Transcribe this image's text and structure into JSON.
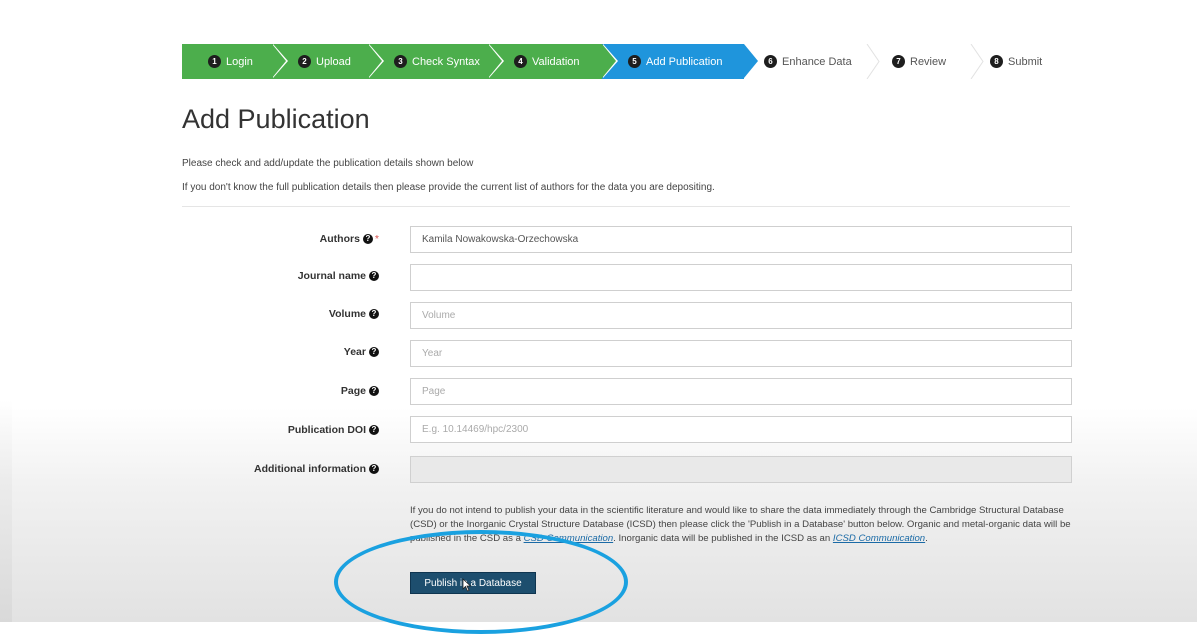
{
  "wizard": {
    "steps": [
      {
        "num": "1",
        "label": "Login",
        "state": "done"
      },
      {
        "num": "2",
        "label": "Upload",
        "state": "done"
      },
      {
        "num": "3",
        "label": "Check Syntax",
        "state": "done"
      },
      {
        "num": "4",
        "label": "Validation",
        "state": "done"
      },
      {
        "num": "5",
        "label": "Add Publication",
        "state": "active"
      },
      {
        "num": "6",
        "label": "Enhance Data",
        "state": "pending"
      },
      {
        "num": "7",
        "label": "Review",
        "state": "pending"
      },
      {
        "num": "8",
        "label": "Submit",
        "state": "pending"
      }
    ]
  },
  "page": {
    "title": "Add Publication",
    "intro_1": "Please check and add/update the publication details shown below",
    "intro_2": "If you don't know the full publication details then please provide the current list of authors for the data you are depositing."
  },
  "form": {
    "authors": {
      "label": "Authors",
      "value": "Kamila Nowakowska-Orzechowska",
      "required_mark": "*"
    },
    "journal": {
      "label": "Journal name",
      "value": "",
      "placeholder": ""
    },
    "volume": {
      "label": "Volume",
      "value": "",
      "placeholder": "Volume"
    },
    "year": {
      "label": "Year",
      "value": "",
      "placeholder": "Year"
    },
    "page": {
      "label": "Page",
      "value": "",
      "placeholder": "Page"
    },
    "doi": {
      "label": "Publication DOI",
      "value": "",
      "placeholder": "E.g. 10.14469/hpc/2300"
    },
    "additional": {
      "label": "Additional information",
      "value": "",
      "placeholder": ""
    }
  },
  "note": {
    "text_1": "If you do not intend to publish your data in the scientific literature and would like to share the data immediately through the Cambridge Structural Database (CSD) or the Inorganic Crystal Structure Database (ICSD) then please click the 'Publish in a Database' button below. Organic and metal-organic data will be published in the CSD as a ",
    "link_1": "CSD Communication",
    "text_2": ". Inorganic data will be published in the ICSD as an ",
    "link_2": "ICSD Communication",
    "text_3": "."
  },
  "actions": {
    "publish_label": "Publish in a Database"
  },
  "colors": {
    "done": "#4cae4c",
    "active": "#1f95dc",
    "highlight_ring": "#1aa1e0",
    "button": "#1d4e6e"
  },
  "icons": {
    "help": "question-circle-icon",
    "cursor": "mouse-pointer-icon"
  }
}
